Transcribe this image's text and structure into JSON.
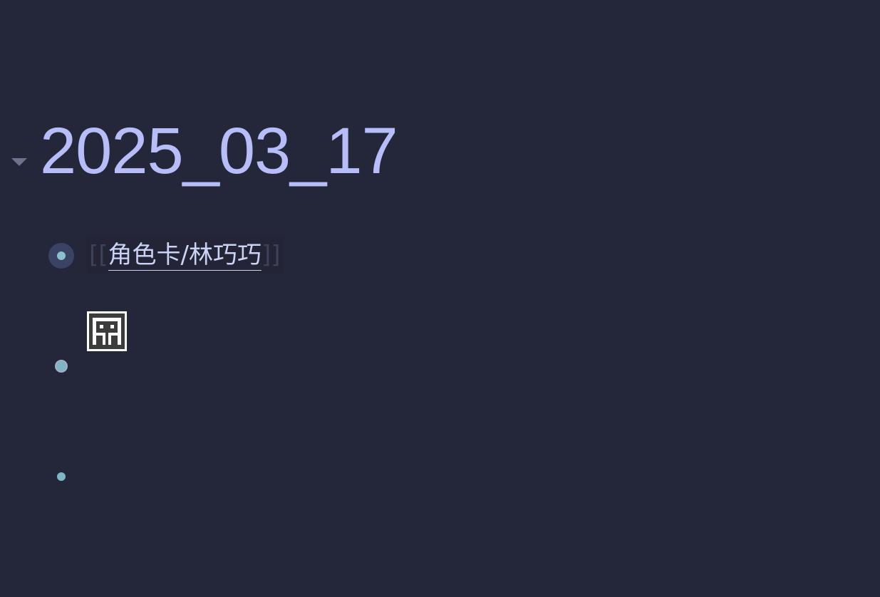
{
  "page": {
    "title": "2025_03_17"
  },
  "blocks": [
    {
      "ref_open": "[[",
      "ref_label": "角色卡/林巧巧",
      "ref_close": "]]"
    },
    {
      "content": "broken-image"
    },
    {
      "content": ""
    }
  ],
  "colors": {
    "background": "#24273a",
    "title": "#b7bdf8",
    "bullet": "#8bc1cf",
    "link": "#cad3f5",
    "toggle": "#6e738d"
  },
  "icons": {
    "toggle": "caret-down-icon",
    "image": "broken-image-icon"
  }
}
